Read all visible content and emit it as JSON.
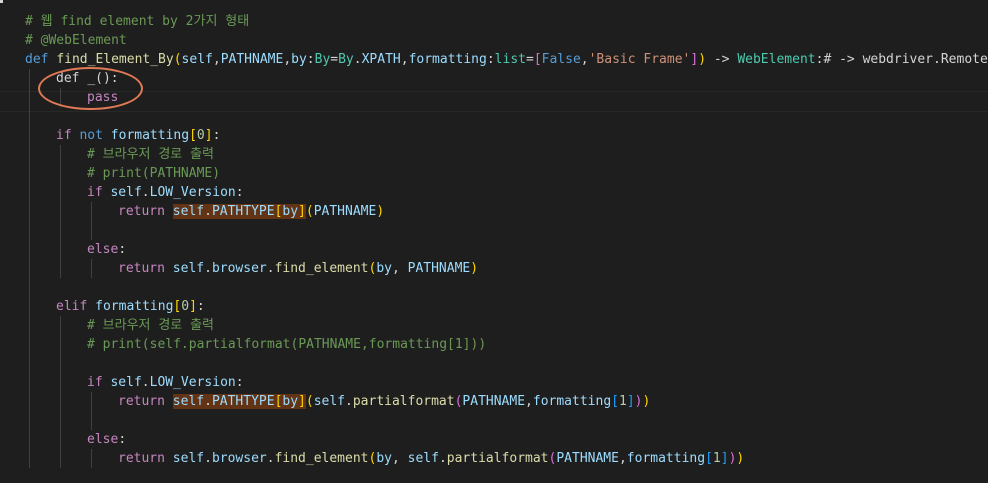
{
  "editor": {
    "lines": [
      {
        "indent": 0,
        "tokens": [
          {
            "t": "# 웹 find element by 2가지 형태",
            "c": "cmt"
          }
        ]
      },
      {
        "indent": 0,
        "tokens": [
          {
            "t": "# @WebElement",
            "c": "cmt"
          }
        ]
      },
      {
        "indent": 0,
        "tokens": [
          {
            "t": "def",
            "c": "kw"
          },
          {
            "t": " ",
            "c": "plain"
          },
          {
            "t": "find_Element_By",
            "c": "fn"
          },
          {
            "t": "(",
            "c": "b1"
          },
          {
            "t": "self",
            "c": "var"
          },
          {
            "t": ",",
            "c": "plain"
          },
          {
            "t": "PATHNAME",
            "c": "var"
          },
          {
            "t": ",",
            "c": "plain"
          },
          {
            "t": "by",
            "c": "var"
          },
          {
            "t": ":",
            "c": "plain"
          },
          {
            "t": "By",
            "c": "cls"
          },
          {
            "t": "=",
            "c": "plain"
          },
          {
            "t": "By",
            "c": "cls"
          },
          {
            "t": ".",
            "c": "plain"
          },
          {
            "t": "XPATH",
            "c": "var"
          },
          {
            "t": ",",
            "c": "plain"
          },
          {
            "t": "formatting",
            "c": "var"
          },
          {
            "t": ":",
            "c": "plain"
          },
          {
            "t": "list",
            "c": "cls"
          },
          {
            "t": "=",
            "c": "plain"
          },
          {
            "t": "[",
            "c": "b2"
          },
          {
            "t": "False",
            "c": "kw"
          },
          {
            "t": ",",
            "c": "plain"
          },
          {
            "t": "'Basic Frame'",
            "c": "str"
          },
          {
            "t": "]",
            "c": "b2"
          },
          {
            "t": ")",
            "c": "b1"
          },
          {
            "t": " -> ",
            "c": "plain"
          },
          {
            "t": "WebElement",
            "c": "cls"
          },
          {
            "t": ":",
            "c": "plain"
          },
          {
            "t": "# -> webdriver.Remote:",
            "c": "plain"
          }
        ]
      },
      {
        "indent": 1,
        "tokens": [
          {
            "t": "def",
            "c": "plain"
          },
          {
            "t": " ",
            "c": "plain"
          },
          {
            "t": "_",
            "c": "plain"
          },
          {
            "t": "():",
            "c": "plain"
          }
        ]
      },
      {
        "indent": 2,
        "tokens": [
          {
            "t": "pass",
            "c": "ctl"
          }
        ]
      },
      {
        "indent": 1,
        "tokens": []
      },
      {
        "indent": 1,
        "tokens": [
          {
            "t": "if",
            "c": "ctl"
          },
          {
            "t": " ",
            "c": "plain"
          },
          {
            "t": "not",
            "c": "kw"
          },
          {
            "t": " ",
            "c": "plain"
          },
          {
            "t": "formatting",
            "c": "var"
          },
          {
            "t": "[",
            "c": "b1"
          },
          {
            "t": "0",
            "c": "num"
          },
          {
            "t": "]",
            "c": "b1"
          },
          {
            "t": ":",
            "c": "plain"
          }
        ]
      },
      {
        "indent": 2,
        "tokens": [
          {
            "t": "# 브라우저 경로 출력",
            "c": "cmt"
          }
        ]
      },
      {
        "indent": 2,
        "tokens": [
          {
            "t": "# print(PATHNAME)",
            "c": "cmt"
          }
        ]
      },
      {
        "indent": 2,
        "tokens": [
          {
            "t": "if",
            "c": "ctl"
          },
          {
            "t": " ",
            "c": "plain"
          },
          {
            "t": "self",
            "c": "var"
          },
          {
            "t": ".",
            "c": "plain"
          },
          {
            "t": "LOW_Version",
            "c": "var"
          },
          {
            "t": ":",
            "c": "plain"
          }
        ]
      },
      {
        "indent": 3,
        "tokens": [
          {
            "t": "return",
            "c": "ctl"
          },
          {
            "t": " ",
            "c": "plain"
          },
          {
            "t": "self",
            "c": "var",
            "h": true
          },
          {
            "t": ".",
            "c": "plain",
            "h": true
          },
          {
            "t": "PATHTYPE",
            "c": "var",
            "h": true
          },
          {
            "t": "[",
            "c": "b1",
            "h": true
          },
          {
            "t": "by",
            "c": "var",
            "h": true
          },
          {
            "t": "]",
            "c": "b1",
            "h": true
          },
          {
            "t": "(",
            "c": "b1"
          },
          {
            "t": "PATHNAME",
            "c": "var"
          },
          {
            "t": ")",
            "c": "b1"
          }
        ]
      },
      {
        "indent": 3,
        "tokens": []
      },
      {
        "indent": 2,
        "tokens": [
          {
            "t": "else",
            "c": "ctl"
          },
          {
            "t": ":",
            "c": "plain"
          }
        ]
      },
      {
        "indent": 3,
        "tokens": [
          {
            "t": "return",
            "c": "ctl"
          },
          {
            "t": " ",
            "c": "plain"
          },
          {
            "t": "self",
            "c": "var"
          },
          {
            "t": ".",
            "c": "plain"
          },
          {
            "t": "browser",
            "c": "var"
          },
          {
            "t": ".",
            "c": "plain"
          },
          {
            "t": "find_element",
            "c": "fn"
          },
          {
            "t": "(",
            "c": "b1"
          },
          {
            "t": "by",
            "c": "var"
          },
          {
            "t": ", ",
            "c": "plain"
          },
          {
            "t": "PATHNAME",
            "c": "var"
          },
          {
            "t": ")",
            "c": "b1"
          }
        ]
      },
      {
        "indent": 1,
        "tokens": []
      },
      {
        "indent": 1,
        "tokens": [
          {
            "t": "elif",
            "c": "ctl"
          },
          {
            "t": " ",
            "c": "plain"
          },
          {
            "t": "formatting",
            "c": "var"
          },
          {
            "t": "[",
            "c": "b1"
          },
          {
            "t": "0",
            "c": "num"
          },
          {
            "t": "]",
            "c": "b1"
          },
          {
            "t": ":",
            "c": "plain"
          }
        ]
      },
      {
        "indent": 2,
        "tokens": [
          {
            "t": "# 브라우저 경로 출력",
            "c": "cmt"
          }
        ]
      },
      {
        "indent": 2,
        "tokens": [
          {
            "t": "# print(self.partialformat(PATHNAME,formatting[1]))",
            "c": "cmt"
          }
        ]
      },
      {
        "indent": 2,
        "tokens": []
      },
      {
        "indent": 2,
        "tokens": [
          {
            "t": "if",
            "c": "ctl"
          },
          {
            "t": " ",
            "c": "plain"
          },
          {
            "t": "self",
            "c": "var"
          },
          {
            "t": ".",
            "c": "plain"
          },
          {
            "t": "LOW_Version",
            "c": "var"
          },
          {
            "t": ":",
            "c": "plain"
          }
        ]
      },
      {
        "indent": 3,
        "tokens": [
          {
            "t": "return",
            "c": "ctl"
          },
          {
            "t": " ",
            "c": "plain"
          },
          {
            "t": "self",
            "c": "var",
            "h": true
          },
          {
            "t": ".",
            "c": "plain",
            "h": true
          },
          {
            "t": "PATHTYPE",
            "c": "var",
            "h": true
          },
          {
            "t": "[",
            "c": "b1",
            "h": true
          },
          {
            "t": "by",
            "c": "var",
            "h": true
          },
          {
            "t": "]",
            "c": "b1",
            "h": true
          },
          {
            "t": "(",
            "c": "b1"
          },
          {
            "t": "self",
            "c": "var"
          },
          {
            "t": ".",
            "c": "plain"
          },
          {
            "t": "partialformat",
            "c": "fn"
          },
          {
            "t": "(",
            "c": "b2"
          },
          {
            "t": "PATHNAME",
            "c": "var"
          },
          {
            "t": ",",
            "c": "plain"
          },
          {
            "t": "formatting",
            "c": "var"
          },
          {
            "t": "[",
            "c": "b3"
          },
          {
            "t": "1",
            "c": "num"
          },
          {
            "t": "]",
            "c": "b3"
          },
          {
            "t": ")",
            "c": "b2"
          },
          {
            "t": ")",
            "c": "b1"
          }
        ]
      },
      {
        "indent": 3,
        "tokens": []
      },
      {
        "indent": 2,
        "tokens": [
          {
            "t": "else",
            "c": "ctl"
          },
          {
            "t": ":",
            "c": "plain"
          }
        ]
      },
      {
        "indent": 3,
        "tokens": [
          {
            "t": "return",
            "c": "ctl"
          },
          {
            "t": " ",
            "c": "plain"
          },
          {
            "t": "self",
            "c": "var"
          },
          {
            "t": ".",
            "c": "plain"
          },
          {
            "t": "browser",
            "c": "var"
          },
          {
            "t": ".",
            "c": "plain"
          },
          {
            "t": "find_element",
            "c": "fn"
          },
          {
            "t": "(",
            "c": "b1"
          },
          {
            "t": "by",
            "c": "var"
          },
          {
            "t": ", ",
            "c": "plain"
          },
          {
            "t": "self",
            "c": "var"
          },
          {
            "t": ".",
            "c": "plain"
          },
          {
            "t": "partialformat",
            "c": "fn"
          },
          {
            "t": "(",
            "c": "b2"
          },
          {
            "t": "PATHNAME",
            "c": "var"
          },
          {
            "t": ",",
            "c": "plain"
          },
          {
            "t": "formatting",
            "c": "var"
          },
          {
            "t": "[",
            "c": "b3"
          },
          {
            "t": "1",
            "c": "num"
          },
          {
            "t": "]",
            "c": "b3"
          },
          {
            "t": ")",
            "c": "b2"
          },
          {
            "t": ")",
            "c": "b1"
          }
        ]
      }
    ]
  },
  "annotation": {
    "color": "#e07a55"
  }
}
